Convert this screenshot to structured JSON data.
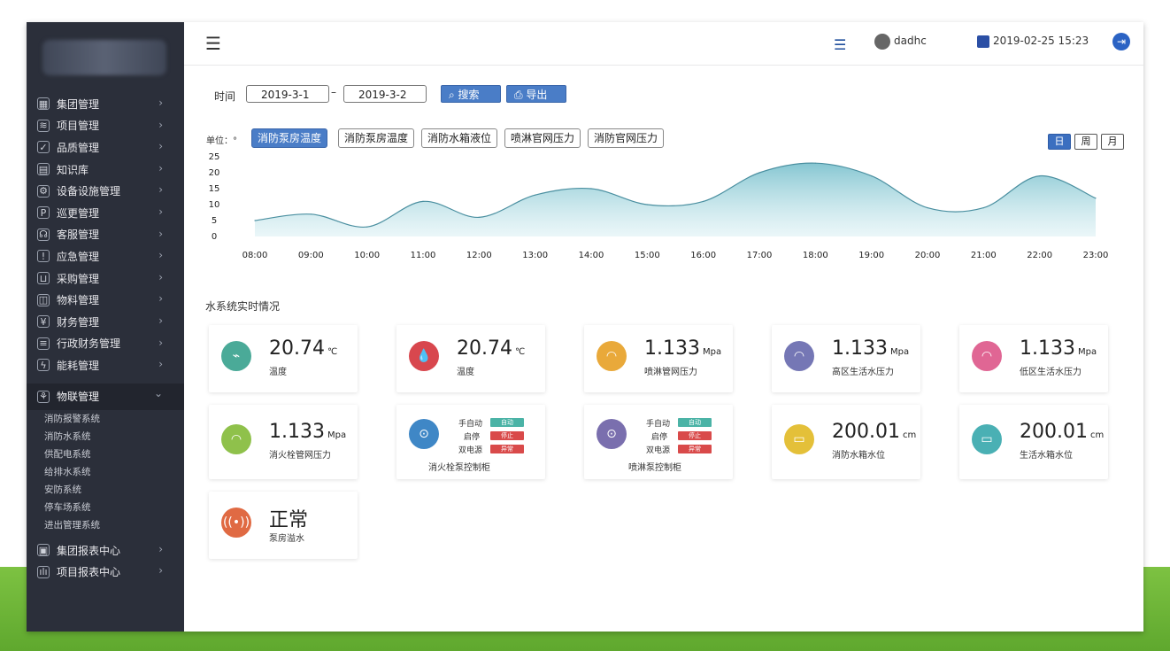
{
  "sidebar": {
    "items": [
      {
        "label": "集团管理",
        "icon": "building-icon"
      },
      {
        "label": "项目管理",
        "icon": "layers-icon"
      },
      {
        "label": "品质管理",
        "icon": "shield-icon"
      },
      {
        "label": "知识库",
        "icon": "book-icon"
      },
      {
        "label": "设备设施管理",
        "icon": "gear-icon"
      },
      {
        "label": "巡更管理",
        "icon": "patrol-icon"
      },
      {
        "label": "客服管理",
        "icon": "headset-icon"
      },
      {
        "label": "应急管理",
        "icon": "alert-icon"
      },
      {
        "label": "采购管理",
        "icon": "cart-icon"
      },
      {
        "label": "物料管理",
        "icon": "box-icon"
      },
      {
        "label": "财务管理",
        "icon": "finance-icon"
      },
      {
        "label": "行政财务管理",
        "icon": "document-icon"
      },
      {
        "label": "能耗管理",
        "icon": "energy-icon"
      }
    ],
    "active": {
      "label": "物联管理",
      "icon": "iot-icon"
    },
    "subitems": [
      "消防报警系统",
      "消防水系统",
      "供配电系统",
      "给排水系统",
      "安防系统",
      "停车场系统",
      "进出管理系统"
    ],
    "bottom_items": [
      {
        "label": "集团报表中心",
        "icon": "report-icon"
      },
      {
        "label": "项目报表中心",
        "icon": "bar-chart-icon"
      }
    ]
  },
  "topbar": {
    "username": "dadhc",
    "datetime": "2019-02-25 15:23"
  },
  "filter": {
    "label": "时间",
    "start": "2019-3-1",
    "end": "2019-3-2",
    "search": "搜索",
    "export": "导出"
  },
  "chart_tabs": {
    "unit_label": "单位：°",
    "tabs": [
      "消防泵房温度",
      "消防泵房温度",
      "消防水箱液位",
      "喷淋官网压力",
      "消防官网压力"
    ],
    "periods": [
      "日",
      "周",
      "月"
    ]
  },
  "chart_data": {
    "type": "area",
    "title": "",
    "xlabel": "",
    "ylabel": "",
    "ylim": [
      0,
      25
    ],
    "yticks": [
      0,
      5,
      10,
      15,
      20,
      25
    ],
    "x": [
      "08:00",
      "09:00",
      "10:00",
      "11:00",
      "12:00",
      "13:00",
      "14:00",
      "15:00",
      "16:00",
      "17:00",
      "18:00",
      "19:00",
      "20:00",
      "21:00",
      "22:00",
      "23:00"
    ],
    "values": [
      5,
      7,
      3,
      11,
      6,
      13,
      15,
      10,
      11,
      20,
      23,
      19,
      9,
      9,
      19,
      12
    ],
    "color": "#7fc3cf",
    "grid": false
  },
  "section_title": "水系统实时情况",
  "cards": [
    {
      "value": "20.74",
      "unit": "℃",
      "label": "温度",
      "icon": "thermometer-icon",
      "color": "#4aaa98"
    },
    {
      "value": "20.74",
      "unit": "℃",
      "label": "温度",
      "icon": "water-drop-icon",
      "color": "#d8474e"
    },
    {
      "value": "1.133",
      "unit": "Mpa",
      "label": "喷淋管网压力",
      "icon": "gauge-icon",
      "color": "#e9a93a"
    },
    {
      "value": "1.133",
      "unit": "Mpa",
      "label": "高区生活水压力",
      "icon": "gauge-icon",
      "color": "#7577b5"
    },
    {
      "value": "1.133",
      "unit": "Mpa",
      "label": "低区生活水压力",
      "icon": "gauge-icon",
      "color": "#e06694"
    },
    {
      "value": "1.133",
      "unit": "Mpa",
      "label": "消火栓管网压力",
      "icon": "gauge-icon",
      "color": "#8fc14b"
    },
    {
      "value": "200.01",
      "unit": "cm",
      "label": "消防水箱水位",
      "icon": "tank-icon",
      "color": "#e4c039"
    },
    {
      "value": "200.01",
      "unit": "cm",
      "label": "生活水箱水位",
      "icon": "tank-icon",
      "color": "#4ab0b4"
    },
    {
      "value": "正常",
      "unit": "",
      "label": "泵房溢水",
      "icon": "signal-icon",
      "color": "#e06a43"
    }
  ],
  "controls": [
    {
      "name": "消火栓泵控制柜",
      "icon": "pump-icon",
      "color": "#3f87c6",
      "rows": [
        {
          "label": "手自动",
          "status": "自动",
          "color": "#4bb3a6"
        },
        {
          "label": "启停",
          "status": "停止",
          "color": "#d94a4a"
        },
        {
          "label": "双电源",
          "status": "异常",
          "color": "#d94a4a"
        }
      ]
    },
    {
      "name": "喷淋泵控制柜",
      "icon": "pump-icon",
      "color": "#7a6fae",
      "rows": [
        {
          "label": "手自动",
          "status": "自动",
          "color": "#4bb3a6"
        },
        {
          "label": "启停",
          "status": "停止",
          "color": "#d94a4a"
        },
        {
          "label": "双电源",
          "status": "异常",
          "color": "#d94a4a"
        }
      ]
    }
  ]
}
